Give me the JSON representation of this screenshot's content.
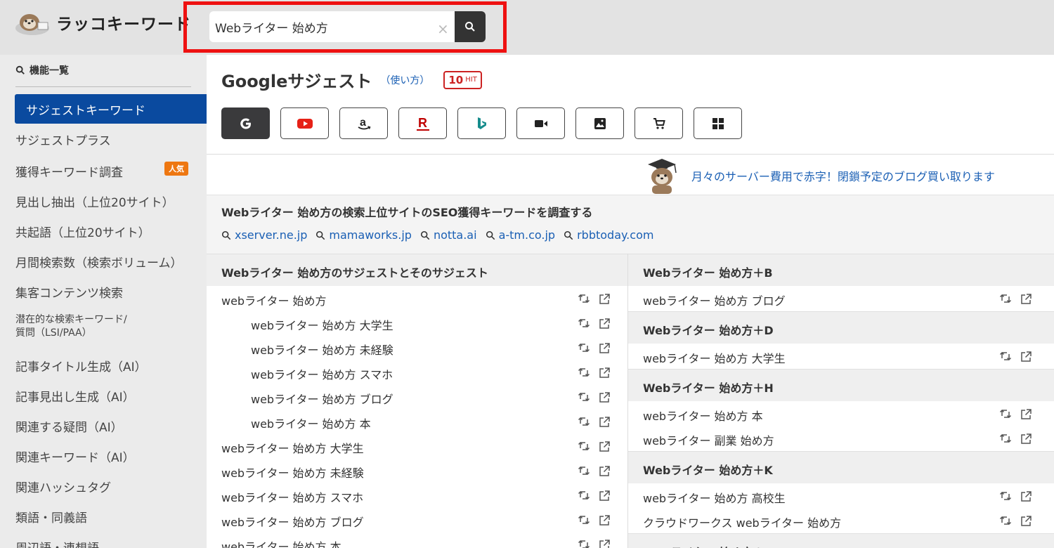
{
  "header": {
    "logo_text": "ラッコキーワード",
    "search_value": "Webライター 始め方",
    "clear_glyph": "×"
  },
  "sidebar": {
    "heading": "機能一覧",
    "active": "サジェストキーワード",
    "items": [
      "サジェストプラス",
      "獲得キーワード調査",
      "見出し抽出（上位20サイト）",
      "共起語（上位20サイト）",
      "月間検索数（検索ボリューム）",
      "集客コンテンツ検索",
      "潜在的な検索キーワード/",
      "質問（LSI/PAA）",
      "記事タイトル生成（AI）",
      "記事見出し生成（AI）",
      "関連する疑問（AI）",
      "関連キーワード（AI）",
      "関連ハッシュタグ",
      "類語・同義語",
      "周辺語・連想語"
    ],
    "badge": "人気"
  },
  "main": {
    "title": "Googleサジェスト",
    "howto": "（使い方）",
    "hit_count": "10",
    "hit_label": "HIT",
    "engines": [
      "google-icon",
      "youtube-icon",
      "amazon-icon",
      "rakuten-icon",
      "bing-icon",
      "video-icon",
      "image-icon",
      "shopping-icon",
      "windows-icon"
    ],
    "banner_text": "月々のサーバー費用で赤字！閉鎖予定のブログ買い取ります",
    "seo_title": "Webライター 始め方の検索上位サイトのSEO獲得キーワードを調査する",
    "seo_links": [
      "xserver.ne.jp",
      "mamaworks.jp",
      "notta.ai",
      "a-tm.co.jp",
      "rbbtoday.com"
    ],
    "left_heading": "Webライター 始め方のサジェストとそのサジェスト",
    "left_rows": [
      "webライター 始め方",
      "webライター 始め方 大学生",
      "webライター 始め方 未経験",
      "webライター 始め方 スマホ",
      "webライター 始め方 ブログ",
      "webライター 始め方 本",
      "webライター 始め方 大学生",
      "webライター 始め方 未経験",
      "webライター 始め方 スマホ",
      "webライター 始め方 ブログ",
      "webライター 始め方 本"
    ],
    "right_groups": [
      {
        "heading": "Webライター 始め方＋B",
        "rows": [
          "webライター 始め方 ブログ"
        ]
      },
      {
        "heading": "Webライター 始め方＋D",
        "rows": [
          "webライター 始め方 大学生"
        ]
      },
      {
        "heading": "Webライター 始め方＋H",
        "rows": [
          "webライター 始め方 本",
          "webライター 副業 始め方"
        ]
      },
      {
        "heading": "Webライター 始め方＋K",
        "rows": [
          "webライター 始め方 高校生",
          "クラウドワークス webライター 始め方"
        ]
      },
      {
        "heading": "Webライター 始め方＋M",
        "rows": []
      }
    ]
  }
}
